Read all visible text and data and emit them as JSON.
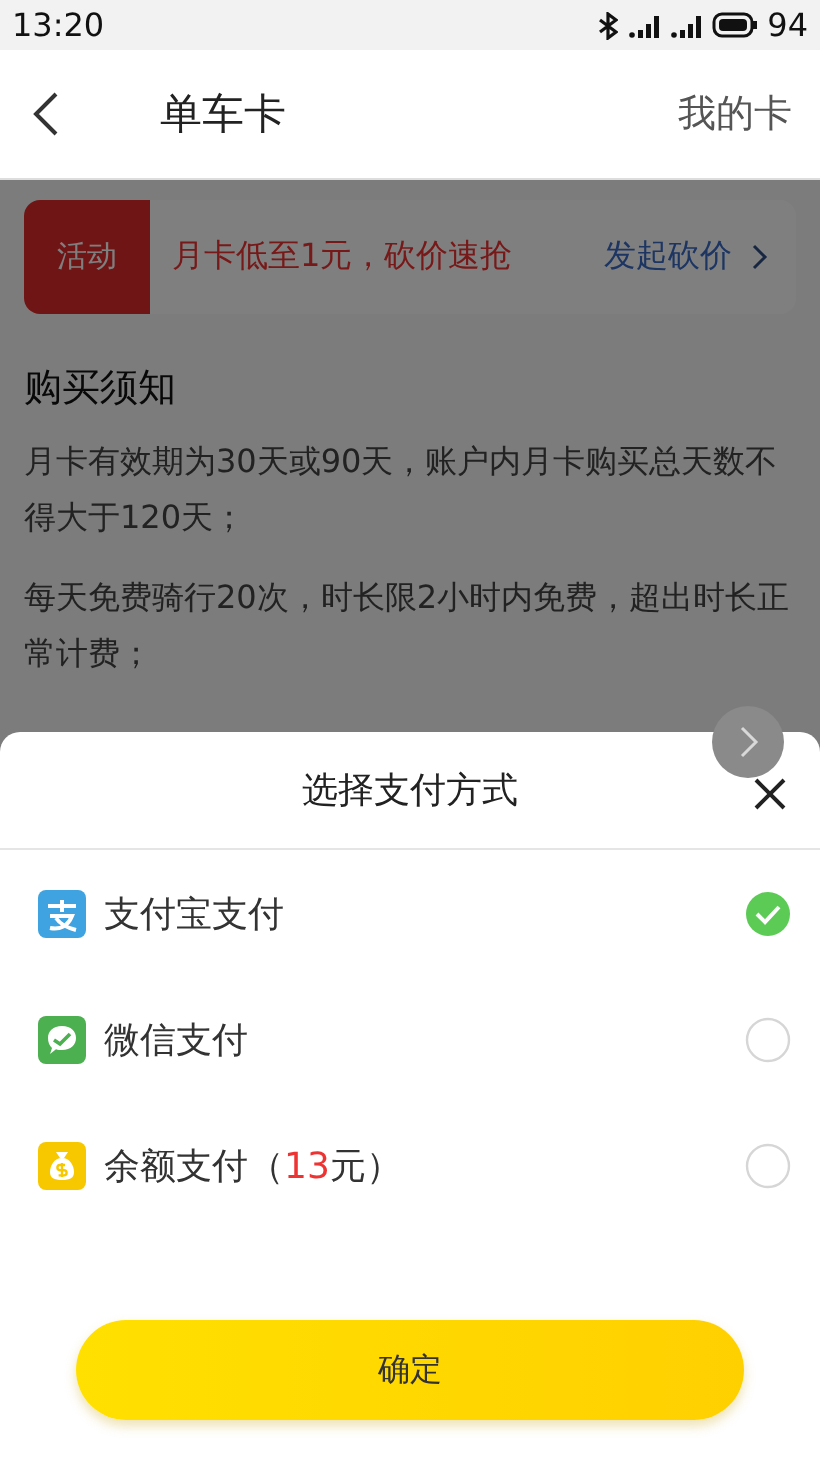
{
  "status_bar": {
    "time": "13:20",
    "battery": "94"
  },
  "header": {
    "title": "单车卡",
    "action": "我的卡"
  },
  "promo": {
    "tag": "活动",
    "text": "月卡低至1元，砍价速抢",
    "link": "发起砍价"
  },
  "notice": {
    "heading": "购买须知",
    "paragraphs": [
      "月卡有效期为30天或90天，账户内月卡购买总天数不得大于120天；",
      "每天免费骑行20次，时长限2小时内免费，超出时长正常计费；"
    ]
  },
  "payment_sheet": {
    "title": "选择支付方式",
    "options": [
      {
        "kind": "alipay",
        "label": "支付宝支付",
        "selected": true
      },
      {
        "kind": "wechat",
        "label": "微信支付",
        "selected": false
      },
      {
        "kind": "balance",
        "label": "余额支付（",
        "amount": "13",
        "label_end": "元）",
        "selected": false
      }
    ],
    "confirm": "确定"
  }
}
